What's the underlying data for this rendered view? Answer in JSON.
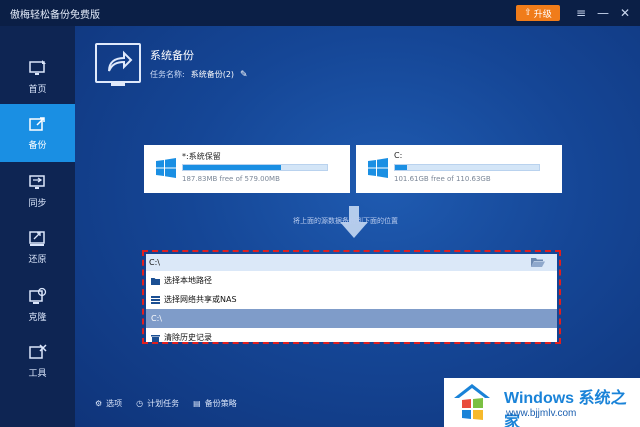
{
  "app": {
    "title": "傲梅轻松备份免费版",
    "upgrade_label": "升级",
    "window_controls": {
      "menu": "≡",
      "minimize": "—",
      "close": "✕"
    }
  },
  "sidebar": {
    "items": [
      {
        "label": "首页",
        "icon": "home-monitor-icon"
      },
      {
        "label": "备份",
        "icon": "backup-icon",
        "active": true
      },
      {
        "label": "同步",
        "icon": "sync-icon"
      },
      {
        "label": "还原",
        "icon": "restore-icon"
      },
      {
        "label": "克隆",
        "icon": "clone-icon"
      },
      {
        "label": "工具",
        "icon": "tools-icon"
      }
    ]
  },
  "header": {
    "title": "系统备份",
    "task_label": "任务名称:",
    "task_value": "系统备份(2)"
  },
  "source": {
    "name": "*:系统保留",
    "free": "187.83MB free of 579.00MB",
    "used_fraction": 0.68
  },
  "target": {
    "name": "C:",
    "free": "101.61GB free of 110.63GB",
    "used_fraction": 0.08
  },
  "hint": "将上面的源数据备份到下面的位置",
  "dropdown": {
    "value": "C:\\",
    "options": [
      {
        "label": "选择本地路径",
        "icon": "folder-icon"
      },
      {
        "label": "选择网络共享或NAS",
        "icon": "network-share-icon"
      },
      {
        "label": "C:\\",
        "selected": true
      },
      {
        "label": "清除历史记录",
        "icon": "clear-history-icon"
      }
    ]
  },
  "footer": {
    "options_label": "选项",
    "schedule_label": "计划任务",
    "strategy_label": "备份策略"
  },
  "watermark": {
    "brand": "Windows",
    "brand_suffix": "系统之家",
    "url": "www.bjjmlv.com"
  },
  "colors": {
    "accent": "#1a8fe3",
    "upgrade": "#f07c1a",
    "selected_option": "#7f9cc9",
    "dashed_outline": "#e01f1f"
  }
}
